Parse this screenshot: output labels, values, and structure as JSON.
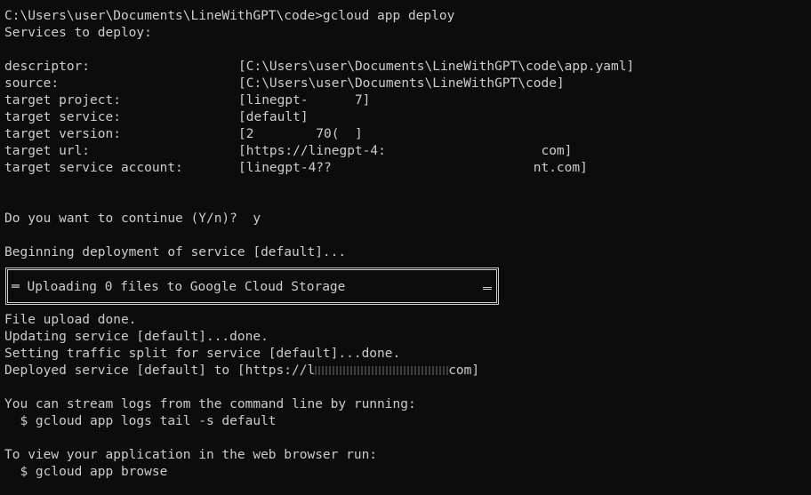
{
  "terminal": {
    "prompt_line": "C:\\Users\\user\\Documents\\LineWithGPT\\code>gcloud app deploy",
    "services_header": "Services to deploy:",
    "fields": [
      {
        "label": "descriptor:",
        "value": "[C:\\Users\\user\\Documents\\LineWithGPT\\code\\app.yaml]"
      },
      {
        "label": "source:",
        "value": "[C:\\Users\\user\\Documents\\LineWithGPT\\code]"
      },
      {
        "label": "target project:",
        "value": "[linegpt-      7]"
      },
      {
        "label": "target service:",
        "value": "[default]"
      },
      {
        "label": "target version:",
        "value": "[2        70(  ]"
      },
      {
        "label": "target url:",
        "value": "[https://linegpt-4:                    com]"
      },
      {
        "label": "target service account:",
        "value": "[linegpt-4??                          nt.com]"
      }
    ],
    "continue_prompt": "Do you want to continue (Y/n)?  y",
    "beginning": "Beginning deployment of service [default]...",
    "upload_box": "═ Uploading 0 files to Google Cloud Storage",
    "upload_done": "File upload done.",
    "updating": "Updating service [default]...done.",
    "traffic": "Setting traffic split for service [default]...done.",
    "deployed_prefix": "Deployed service [default] to [https://l",
    "deployed_suffix": "com]",
    "stream_logs": "You can stream logs from the command line by running:",
    "logs_cmd": "  $ gcloud app logs tail -s default",
    "view_app": "To view your application in the web browser run:",
    "browse_cmd": "  $ gcloud app browse"
  }
}
